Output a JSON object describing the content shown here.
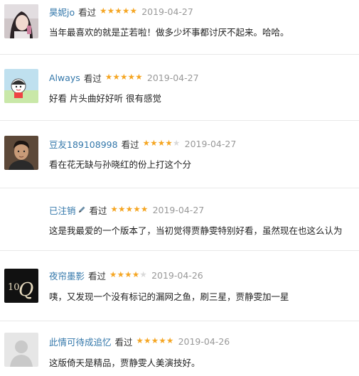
{
  "reviews": [
    {
      "username": "昊妮jo",
      "status": "看过",
      "rating": 5,
      "date": "2019-04-27",
      "text": "当年最喜欢的就是芷若啦！做多少坏事都讨厌不起来。哈哈。",
      "avatar": "girl-photo-avatar"
    },
    {
      "username": "Always",
      "status": "看过",
      "rating": 5,
      "date": "2019-04-27",
      "text": "好看 片头曲好好听 很有感觉",
      "avatar": "cartoon-avatar"
    },
    {
      "username": "豆友189108998",
      "status": "看过",
      "rating": 4,
      "date": "2019-04-27",
      "text": "看在花无缺与孙晓红的份上打这个分",
      "avatar": "man-photo-avatar"
    },
    {
      "username": "已注销",
      "status": "看过",
      "rating": 5,
      "date": "2019-04-27",
      "text": "这是我最爱的一个版本了，当初觉得贾静雯特别好看，虽然现在也这么认为",
      "avatar": "none"
    },
    {
      "username": "夜帘墨影",
      "status": "看过",
      "rating": 4,
      "date": "2019-04-26",
      "text": "咦，又发现一个没有标记的漏网之鱼，刷三星，贾静雯加一星",
      "avatar": "10q-logo-avatar"
    },
    {
      "username": "此情可待成追忆",
      "status": "看过",
      "rating": 5,
      "date": "2019-04-26",
      "text": "这版倚天是精品，贾静雯人美演技好。",
      "avatar": "default-person-avatar"
    }
  ],
  "colors": {
    "username": "#3377aa",
    "star_on": "#f5a623",
    "star_off": "#d9d9d9",
    "date": "#999999"
  }
}
